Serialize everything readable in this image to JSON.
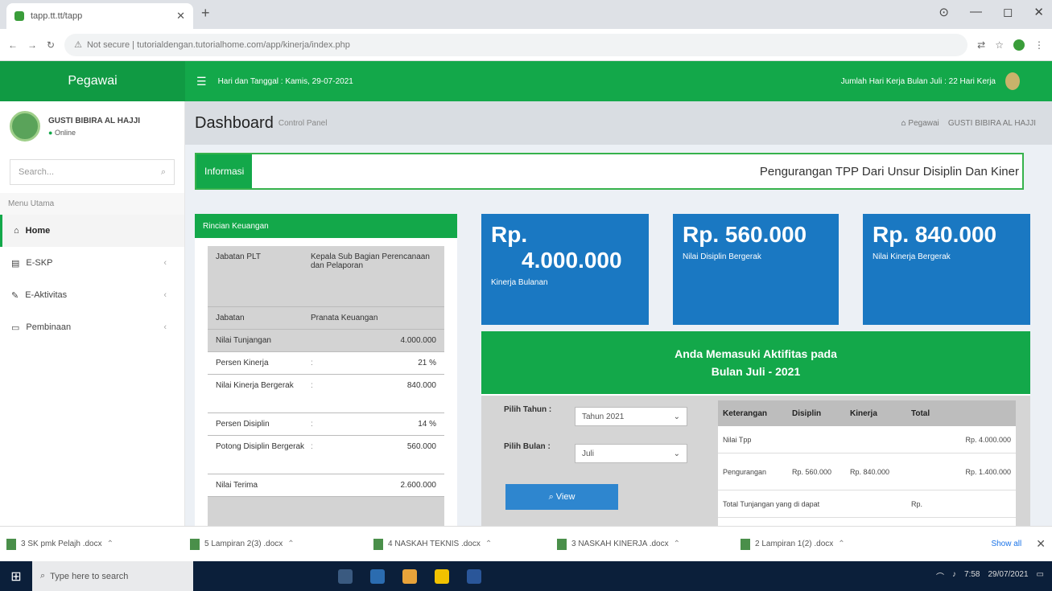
{
  "browser": {
    "tab_title": "tapp.tt.tt/tapp",
    "url": "Not secure | tutorialdengan.tutorialhome.com/app/kinerja/index.php",
    "window_controls": [
      "⊙",
      "—",
      "◻",
      "✕"
    ]
  },
  "navbar": {
    "brand": "Pegawai",
    "menu_icon": "☰",
    "date_text": "Hari dan Tanggal : Kamis, 29-07-2021",
    "right_text": "Jumlah Hari Kerja Bulan Juli : 22 Hari Kerja"
  },
  "sidebar": {
    "user_name": "GUSTI BIBIRA AL HAJJI",
    "user_status": "Online",
    "search_placeholder": "Search...",
    "menu_header": "Menu Utama",
    "items": [
      {
        "label": "Home",
        "icon": "⌂"
      },
      {
        "label": "E-SKP",
        "icon": "▤"
      },
      {
        "label": "E-Aktivitas",
        "icon": "✎"
      },
      {
        "label": "Pembinaan",
        "icon": "▭"
      }
    ]
  },
  "content": {
    "title": "Dashboard",
    "subtitle": "Control Panel",
    "breadcrumb_home": "Pegawai",
    "breadcrumb_current": "GUSTI BIBIRA AL HAJJI"
  },
  "info": {
    "tag": "Informasi",
    "marquee": "Pengurangan TPP Dari Unsur Disiplin Dan Kiner"
  },
  "keuangan": {
    "header": "Rincian Keuangan",
    "rows": [
      {
        "k": "Jabatan PLT",
        "v": "Kepala Sub Bagian Perencanaan dan Pelaporan"
      },
      {
        "k": "Jabatan",
        "v": "Pranata Keuangan"
      },
      {
        "k": "Nilai Tunjangan",
        "r": "4.000.000"
      },
      {
        "k": "Persen Kinerja",
        "c": ":",
        "r": "21 %"
      },
      {
        "k": "Nilai Kinerja Bergerak",
        "c": ":",
        "r": "840.000"
      },
      {
        "k": "Persen Disiplin",
        "c": ":",
        "r": "14 %"
      },
      {
        "k": "Potong Disiplin Bergerak",
        "c": ":",
        "r": "560.000"
      },
      {
        "k": "Nilai Terima",
        "r": "2.600.000"
      }
    ]
  },
  "stats": [
    {
      "value_prefix": "Rp.",
      "value_main": "4.000.000",
      "label": "Kinerja Bulanan"
    },
    {
      "value": "Rp. 560.000",
      "label": "Nilai Disiplin Bergerak"
    },
    {
      "value": "Rp. 840.000",
      "label": "Nilai Kinerja Bergerak"
    }
  ],
  "aktivitas": {
    "line1": "Anda Memasuki Aktifitas pada",
    "line2": "Bulan Juli - 2021",
    "filter_tahun_label": "Pilih Tahun :",
    "filter_tahun_value": "Tahun 2021",
    "filter_bulan_label": "Pilih Bulan :",
    "filter_bulan_value": "Juli",
    "view_button": "View",
    "table": {
      "headers": [
        "Keterangan",
        "Disiplin",
        "Kinerja",
        "Total"
      ],
      "rows": [
        [
          "Nilai Tpp",
          "",
          "",
          "Rp. 4.000.000"
        ],
        [
          "Pengurangan",
          "Rp. 560.000",
          "Rp. 840.000",
          "Rp. 1.400.000"
        ],
        [
          "Total Tunjangan yang di dapat",
          "",
          "",
          "Rp."
        ]
      ]
    }
  },
  "downloads": [
    "3 SK pmk Pelajh .docx",
    "5 Lampiran 2(3) .docx",
    "4 NASKAH TEKNIS .docx",
    "3 NASKAH KINERJA .docx",
    "2 Lampiran 1(2) .docx"
  ],
  "downloads_show_all": "Show all",
  "taskbar": {
    "search_placeholder": "Type here to search",
    "time": "7:58",
    "date": "29/07/2021"
  }
}
